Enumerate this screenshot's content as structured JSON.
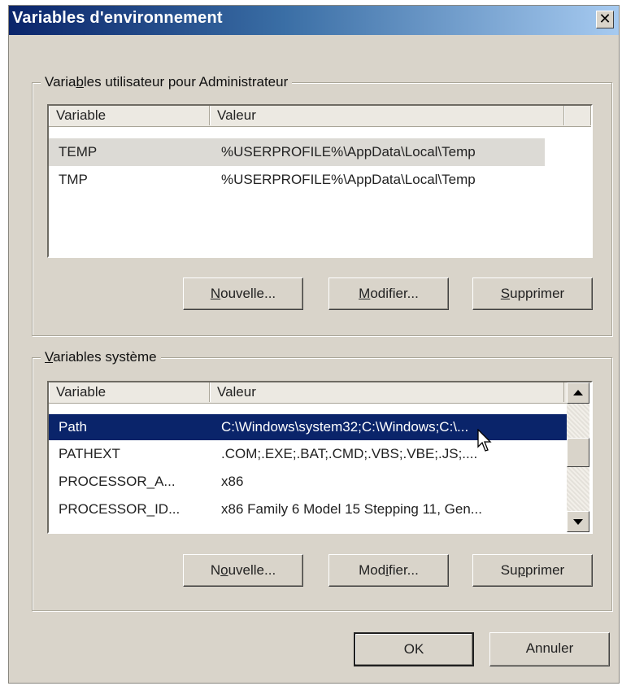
{
  "window": {
    "title": "Variables d'environnement",
    "close_glyph": "✕"
  },
  "user_group": {
    "legend_before": "Varia",
    "legend_ul": "b",
    "legend_after": "les utilisateur pour Administrateur",
    "columns": [
      "Variable",
      "Valeur"
    ],
    "rows": [
      {
        "variable": "TEMP",
        "value": "%USERPROFILE%\\AppData\\Local\\Temp"
      },
      {
        "variable": "TMP",
        "value": "%USERPROFILE%\\AppData\\Local\\Temp"
      }
    ],
    "buttons": {
      "new": {
        "ul": "N",
        "rest": "ouvelle..."
      },
      "edit": {
        "ul": "M",
        "rest": "odifier..."
      },
      "delete": {
        "ul": "S",
        "rest": "upprimer"
      }
    }
  },
  "system_group": {
    "legend_ul": "V",
    "legend_rest": "ariables système",
    "columns": [
      "Variable",
      "Valeur"
    ],
    "rows": [
      {
        "variable": "Path",
        "value": "C:\\Windows\\system32;C:\\Windows;C:\\..."
      },
      {
        "variable": "PATHEXT",
        "value": ".COM;.EXE;.BAT;.CMD;.VBS;.VBE;.JS;...."
      },
      {
        "variable": "PROCESSOR_A...",
        "value": "x86"
      },
      {
        "variable": "PROCESSOR_ID...",
        "value": "x86 Family 6 Model 15 Stepping 11, Gen..."
      }
    ],
    "buttons": {
      "new": {
        "before": "N",
        "ul": "o",
        "rest": "uvelle..."
      },
      "edit": {
        "before": "Mod",
        "ul": "i",
        "rest": "fier..."
      },
      "delete": {
        "before": "Su",
        "ul": "p",
        "rest": "primer"
      }
    }
  },
  "footer": {
    "ok": "OK",
    "cancel": "Annuler"
  },
  "colors": {
    "selection": "#0a246a",
    "dialog_bg": "#d9d4ca"
  }
}
